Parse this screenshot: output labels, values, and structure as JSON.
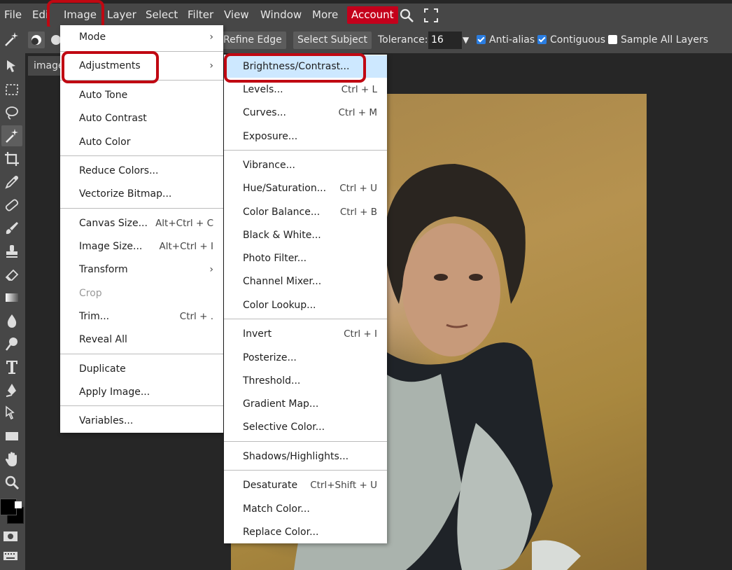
{
  "menubar": {
    "items": [
      "File",
      "Edi",
      "Image",
      "Layer",
      "Select",
      "Filter",
      "View",
      "Window",
      "More"
    ],
    "account": "Account",
    "icons": [
      "search-icon",
      "fullscreen-icon"
    ]
  },
  "options_bar": {
    "refine_edge": "Refine Edge",
    "select_subject": "Select Subject",
    "tolerance_label": "Tolerance:",
    "tolerance_value": "16",
    "anti_alias": "Anti-alias",
    "anti_alias_checked": true,
    "contiguous": "Contiguous",
    "contiguous_checked": true,
    "sample_all_layers": "Sample All Layers",
    "sample_all_layers_checked": false
  },
  "doc_tab": {
    "label": "image"
  },
  "image_menu": {
    "items": [
      {
        "label": "Mode",
        "submenu": true
      },
      {
        "label": "Adjustments",
        "submenu": true
      },
      {
        "label": "Auto Tone"
      },
      {
        "label": "Auto Contrast"
      },
      {
        "label": "Auto Color"
      },
      {
        "label": "Reduce Colors..."
      },
      {
        "label": "Vectorize Bitmap..."
      },
      {
        "label": "Canvas Size...",
        "shortcut": "Alt+Ctrl + C"
      },
      {
        "label": "Image Size...",
        "shortcut": "Alt+Ctrl + I"
      },
      {
        "label": "Transform",
        "submenu": true
      },
      {
        "label": "Crop",
        "disabled": true
      },
      {
        "label": "Trim...",
        "shortcut": "Ctrl + ."
      },
      {
        "label": "Reveal All"
      },
      {
        "label": "Duplicate"
      },
      {
        "label": "Apply Image..."
      },
      {
        "label": "Variables..."
      }
    ]
  },
  "adjustments_menu": {
    "items": [
      {
        "label": "Brightness/Contrast...",
        "highlighted": true
      },
      {
        "label": "Levels...",
        "shortcut": "Ctrl + L"
      },
      {
        "label": "Curves...",
        "shortcut": "Ctrl + M"
      },
      {
        "label": "Exposure..."
      },
      {
        "label": "Vibrance..."
      },
      {
        "label": "Hue/Saturation...",
        "shortcut": "Ctrl + U"
      },
      {
        "label": "Color Balance...",
        "shortcut": "Ctrl + B"
      },
      {
        "label": "Black & White..."
      },
      {
        "label": "Photo Filter..."
      },
      {
        "label": "Channel Mixer..."
      },
      {
        "label": "Color Lookup..."
      },
      {
        "label": "Invert",
        "shortcut": "Ctrl + I"
      },
      {
        "label": "Posterize..."
      },
      {
        "label": "Threshold..."
      },
      {
        "label": "Gradient Map..."
      },
      {
        "label": "Selective Color..."
      },
      {
        "label": "Shadows/Highlights..."
      },
      {
        "label": "Desaturate",
        "shortcut": "Ctrl+Shift + U"
      },
      {
        "label": "Match Color..."
      },
      {
        "label": "Replace Color..."
      }
    ]
  },
  "colors": {
    "accent_red": "#c00812",
    "account_bg": "#c4001b",
    "menu_highlight": "#cde8ff",
    "checkbox_blue": "#2a7de1"
  }
}
